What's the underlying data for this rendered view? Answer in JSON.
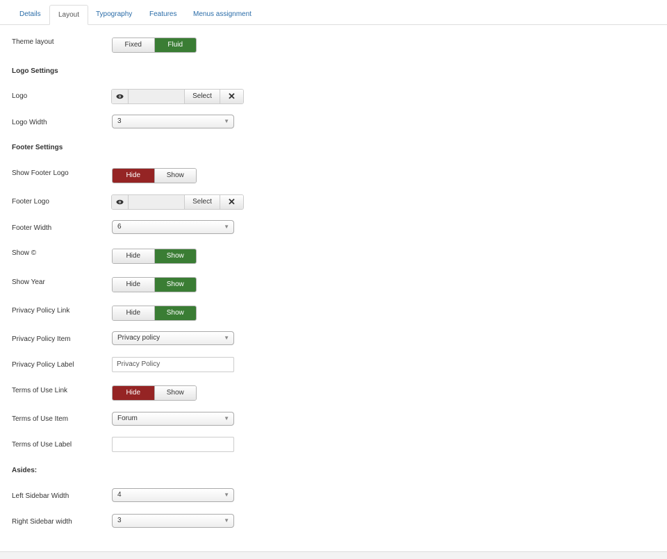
{
  "tabs": [
    {
      "label": "Details"
    },
    {
      "label": "Layout"
    },
    {
      "label": "Typography"
    },
    {
      "label": "Features"
    },
    {
      "label": "Menus assignment"
    }
  ],
  "theme_layout": {
    "label": "Theme layout",
    "options": [
      "Fixed",
      "Fluid"
    ],
    "selected": "Fluid"
  },
  "logo_settings": {
    "heading": "Logo Settings"
  },
  "logo": {
    "label": "Logo",
    "select_label": "Select",
    "value": ""
  },
  "logo_width": {
    "label": "Logo Width",
    "value": "3"
  },
  "footer_settings": {
    "heading": "Footer Settings"
  },
  "show_footer_logo": {
    "label": "Show Footer Logo",
    "options": [
      "Hide",
      "Show"
    ],
    "selected": "Hide"
  },
  "footer_logo": {
    "label": "Footer Logo",
    "select_label": "Select",
    "value": ""
  },
  "footer_width": {
    "label": "Footer Width",
    "value": "6"
  },
  "show_copyright": {
    "label": "Show ©",
    "options": [
      "Hide",
      "Show"
    ],
    "selected": "Show"
  },
  "show_year": {
    "label": "Show Year",
    "options": [
      "Hide",
      "Show"
    ],
    "selected": "Show"
  },
  "privacy_link": {
    "label": "Privacy Policy Link",
    "options": [
      "Hide",
      "Show"
    ],
    "selected": "Show"
  },
  "privacy_item": {
    "label": "Privacy Policy Item",
    "value": "Privacy policy"
  },
  "privacy_label": {
    "label": "Privacy Policy Label",
    "value": "Privacy Policy"
  },
  "terms_link": {
    "label": "Terms of Use Link",
    "options": [
      "Hide",
      "Show"
    ],
    "selected": "Hide"
  },
  "terms_item": {
    "label": "Terms of Use Item",
    "value": "Forum"
  },
  "terms_label": {
    "label": "Terms of Use Label",
    "value": ""
  },
  "asides": {
    "heading": "Asides:"
  },
  "left_sidebar": {
    "label": "Left Sidebar Width",
    "value": "4"
  },
  "right_sidebar": {
    "label": "Right Sidebar width",
    "value": "3"
  },
  "colors": {
    "green": "#3a7d34",
    "red": "#952424",
    "link": "#2a6ca8"
  }
}
